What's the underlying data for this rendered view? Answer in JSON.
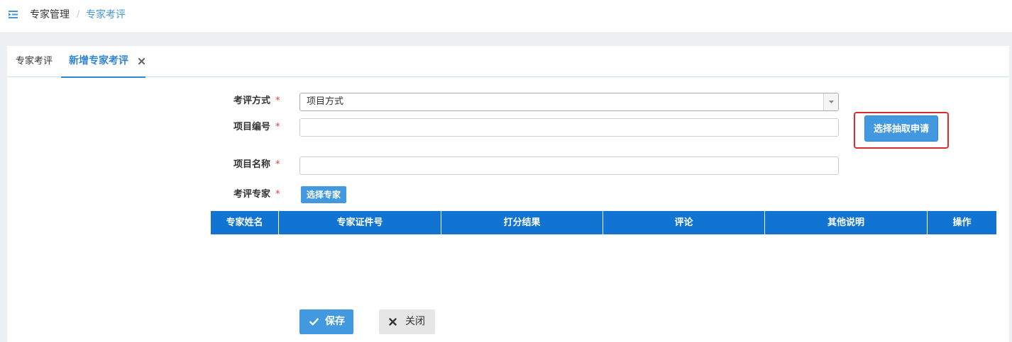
{
  "breadcrumb": {
    "icon": "menu-list-icon",
    "parent": "专家管理",
    "separator": "/",
    "current": "专家考评"
  },
  "tabs": [
    {
      "label": "专家考评",
      "active": false
    },
    {
      "label": "新增专家考评",
      "active": true,
      "close_icon": "close-icon"
    }
  ],
  "form": {
    "review_method": {
      "label": "考评方式",
      "required_mark": "*",
      "value": "项目方式",
      "dropdown_icon": "chevron-down-icon"
    },
    "project_number": {
      "label": "项目编号",
      "required_mark": "*",
      "value": ""
    },
    "select_application_button": "选择抽取申请",
    "project_name": {
      "label": "项目名称",
      "required_mark": "*",
      "value": ""
    },
    "reviewers": {
      "label": "考评专家",
      "required_mark": "*"
    },
    "select_expert_button": "选择专家"
  },
  "expert_table": {
    "columns": [
      "专家姓名",
      "专家证件号",
      "打分结果",
      "评论",
      "其他说明",
      "操作"
    ],
    "rows": []
  },
  "actions": {
    "save": {
      "label": "保存",
      "icon": "check-icon"
    },
    "close": {
      "label": "关闭",
      "icon": "close-icon"
    }
  },
  "colors": {
    "table_header": "#1174d2",
    "primary_button": "#4399e0",
    "secondary_button": "#e6e6e6",
    "link": "#4596d8",
    "active_tab": "#2f85d3",
    "required": "#e4393c",
    "highlight": "#e02a2a"
  }
}
